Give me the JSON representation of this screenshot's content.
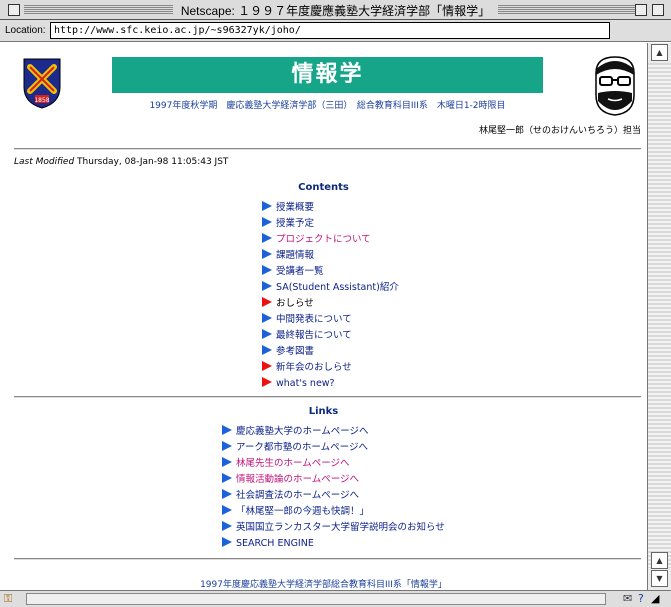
{
  "window": {
    "title": "Netscape: １９９７年度慶應義塾大学経済学部「情報学」"
  },
  "location": {
    "label": "Location:",
    "url": "http://www.sfc.keio.ac.jp/~s96327yk/joho/"
  },
  "header": {
    "banner": "情報学",
    "subtitle": "1997年度秋学期　慶応義塾大学経済学部（三田）　総合教育科目III系　木曜日1-2時限目",
    "author": "林尾堅一郎（せのおけんいちろう）担当",
    "crest_text": "1858"
  },
  "last_modified": {
    "label": "Last Modified",
    "value": "Thursday, 08-Jan-98 11:05:43 JST"
  },
  "contents": {
    "title": "Contents",
    "items": [
      {
        "label": "授業概要",
        "style": "link",
        "marker": "blue"
      },
      {
        "label": "授業予定",
        "style": "link",
        "marker": "blue"
      },
      {
        "label": "プロジェクトについて",
        "style": "visited",
        "marker": "blue"
      },
      {
        "label": "課題情報",
        "style": "link",
        "marker": "blue"
      },
      {
        "label": "受講者一覧",
        "style": "link",
        "marker": "blue"
      },
      {
        "label": "SA(Student Assistant)紹介",
        "style": "link",
        "marker": "blue"
      },
      {
        "label": "おしらせ",
        "style": "plain",
        "marker": "red"
      },
      {
        "label": "中間発表について",
        "style": "link",
        "marker": "blue"
      },
      {
        "label": "最終報告について",
        "style": "link",
        "marker": "blue"
      },
      {
        "label": "参考図書",
        "style": "link",
        "marker": "blue"
      },
      {
        "label": "新年会のおしらせ",
        "style": "link",
        "marker": "red"
      },
      {
        "label": "what's new?",
        "style": "link",
        "marker": "red"
      }
    ]
  },
  "links": {
    "title": "Links",
    "items": [
      {
        "label": "慶応義塾大学のホームページへ",
        "style": "link"
      },
      {
        "label": "アーク都市塾のホームページへ",
        "style": "link"
      },
      {
        "label": "林尾先生のホームページへ",
        "style": "visited"
      },
      {
        "label": "情報活動論のホームページへ",
        "style": "visited"
      },
      {
        "label": "社会調査法のホームページへ",
        "style": "link"
      },
      {
        "label": "「林尾堅一郎の今週も快調！」",
        "style": "link"
      },
      {
        "label": "英国国立ランカスター大学留学説明会のお知らせ",
        "style": "link"
      },
      {
        "label": "SEARCH ENGINE",
        "style": "link"
      }
    ]
  },
  "footer": {
    "text": "1997年度慶応義塾大学経済学部総合教育科目III系「情報学」"
  },
  "colors": {
    "banner": "#17a58a",
    "link": "#0a1f8a",
    "visited": "#c0147a",
    "marker_blue": "#1b62d8",
    "marker_red": "#e11111"
  }
}
